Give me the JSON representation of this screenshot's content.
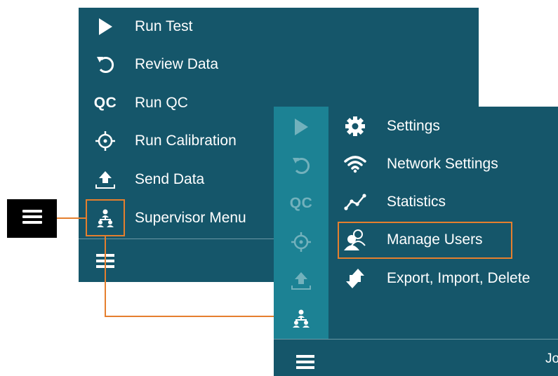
{
  "main_menu": {
    "items": [
      {
        "label": "Run Test",
        "icon": "play-icon"
      },
      {
        "label": "Review Data",
        "icon": "undo-icon"
      },
      {
        "label": "Run QC",
        "icon": "qc-icon",
        "icon_text": "QC"
      },
      {
        "label": "Run Calibration",
        "icon": "crosshair-icon"
      },
      {
        "label": "Send Data",
        "icon": "upload-icon"
      },
      {
        "label": "Supervisor Menu",
        "icon": "supervisor-icon"
      }
    ],
    "hamburger": "hamburger-icon"
  },
  "supervisor_menu": {
    "rail": {
      "qc_text": "QC"
    },
    "items": [
      {
        "label": "Settings",
        "icon": "gear-icon"
      },
      {
        "label": "Network Settings",
        "icon": "wifi-icon"
      },
      {
        "label": "Statistics",
        "icon": "chart-line-icon"
      },
      {
        "label": "Manage Users",
        "icon": "users-icon"
      },
      {
        "label": "Export, Import, Delete",
        "icon": "transfer-icon"
      }
    ],
    "footer_user": "Jo"
  },
  "colors": {
    "panel": "#15566a",
    "rail": "#1c8294",
    "highlight": "#e57f2e",
    "callout": "#000000"
  }
}
